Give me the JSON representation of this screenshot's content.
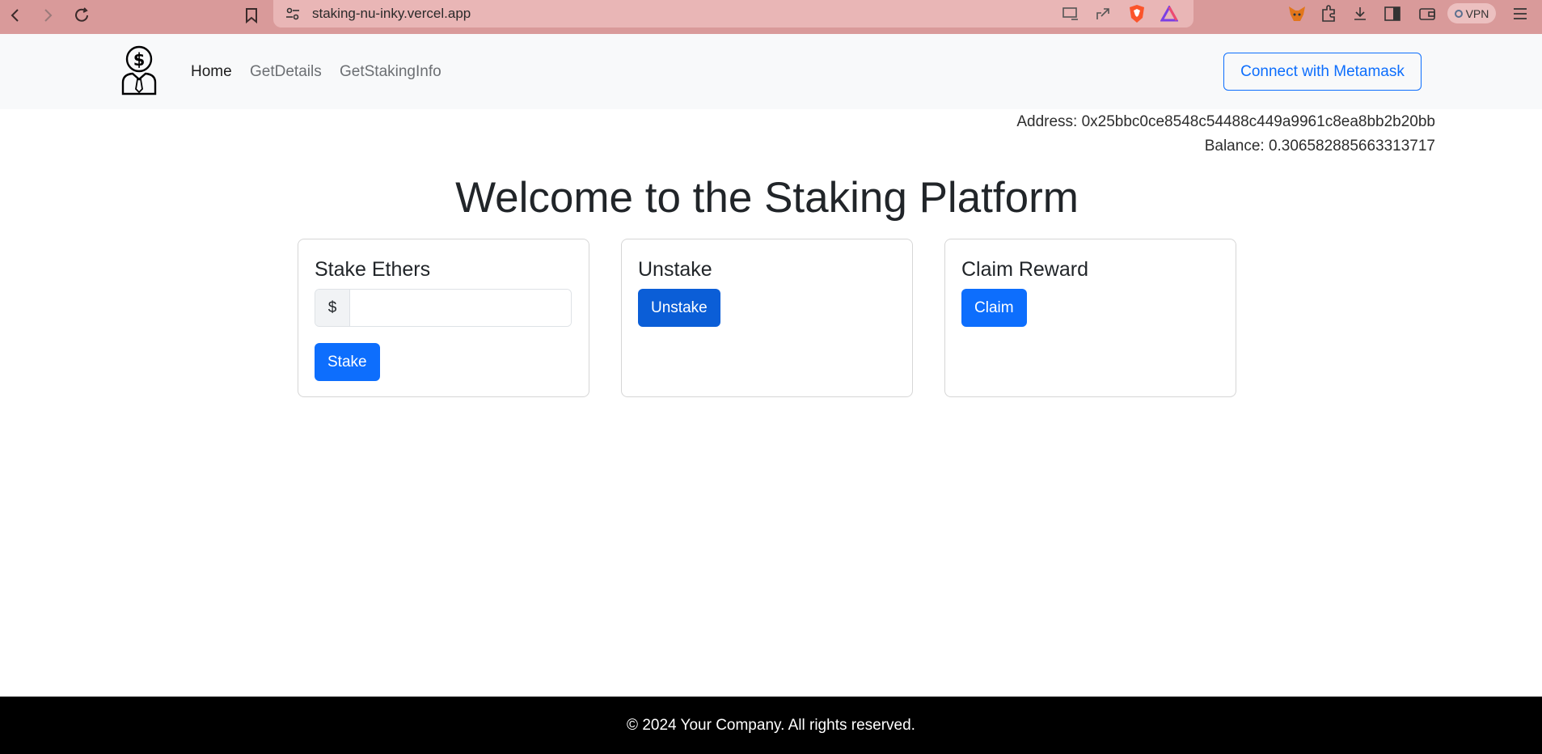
{
  "browser": {
    "url": "staking-nu-inky.vercel.app",
    "vpn_label": "VPN"
  },
  "navbar": {
    "links": [
      {
        "label": "Home"
      },
      {
        "label": "GetDetails"
      },
      {
        "label": "GetStakingInfo"
      }
    ],
    "connect_label": "Connect with Metamask"
  },
  "account": {
    "address": "Address: 0x25bbc0ce8548c54488c449a9961c8ea8bb2b20bb",
    "balance": "Balance: 0.306582885663313717"
  },
  "main": {
    "welcome": "Welcome to the Staking Platform"
  },
  "cards": {
    "stake": {
      "title": "Stake Ethers",
      "currency": "$",
      "input_value": "",
      "button_label": "Stake"
    },
    "unstake": {
      "title": "Unstake",
      "button_label": "Unstake"
    },
    "claim": {
      "title": "Claim Reward",
      "button_label": "Claim"
    }
  },
  "footer": {
    "text": "© 2024 Your Company. All rights reserved."
  },
  "colors": {
    "primary": "#0d6efd",
    "browser_bar": "#d99a9a",
    "footer_bg": "#000000"
  }
}
